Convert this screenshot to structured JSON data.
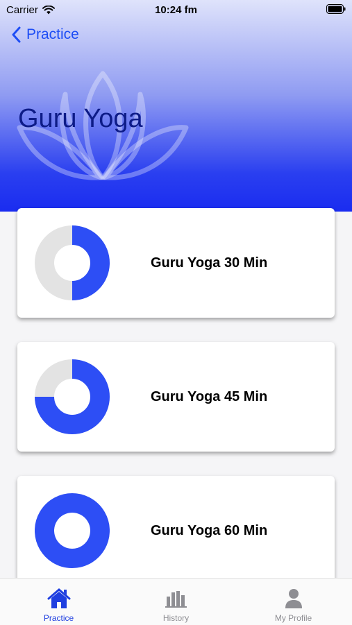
{
  "status_bar": {
    "carrier": "Carrier",
    "time": "10:24 fm"
  },
  "nav": {
    "back_label": "Practice",
    "title": "Guru Yoga"
  },
  "sessions": [
    {
      "label": "Guru Yoga 30 Min",
      "progress": 0.5
    },
    {
      "label": "Guru Yoga 45 Min",
      "progress": 0.75
    },
    {
      "label": "Guru Yoga 60 Min",
      "progress": 1.0
    }
  ],
  "tab_bar": {
    "items": [
      {
        "label": "Practice",
        "icon": "home-icon",
        "active": true
      },
      {
        "label": "History",
        "icon": "bar-chart-icon",
        "active": false
      },
      {
        "label": "My Profile",
        "icon": "person-icon",
        "active": false
      }
    ]
  },
  "colors": {
    "accent": "#2d4ef5",
    "track": "#e3e3e3",
    "inactive": "#8e8e93",
    "title": "#0d1b87"
  }
}
